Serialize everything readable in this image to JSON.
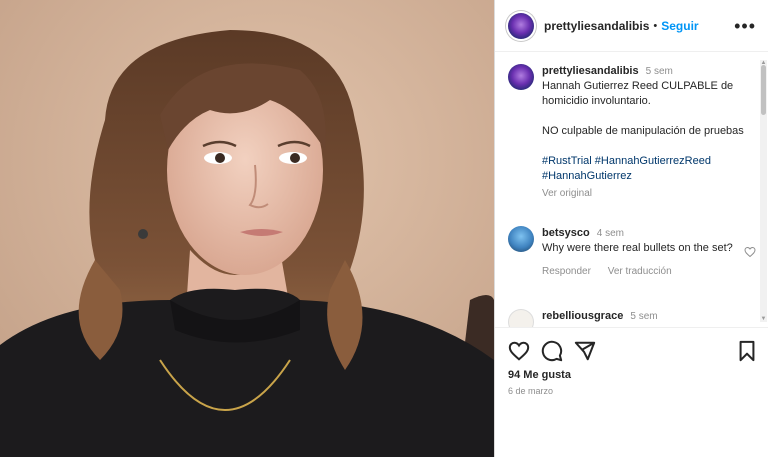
{
  "post": {
    "username": "prettyliesandalibis",
    "follow_label": "Seguir",
    "separator": "•",
    "more_label": "•••"
  },
  "caption": {
    "username": "prettyliesandalibis",
    "time": "5 sem",
    "line1": "Hannah Gutierrez Reed CULPABLE de homicidio involuntario.",
    "line2": "NO culpable de manipulación de pruebas",
    "hashtags": [
      "#RustTrial",
      "#HannahGutierrezReed",
      "#HannahGutierrez"
    ],
    "translate": "Ver original"
  },
  "comments": [
    {
      "username": "betsysco",
      "time": "4 sem",
      "text": "Why were there real bullets on the set?",
      "reply": "Responder",
      "translate": "Ver traducción"
    },
    {
      "username": "rebelliousgrace",
      "time": "5 sem",
      "text": ""
    }
  ],
  "actions": {
    "likes": "94 Me gusta",
    "date": "6 de marzo"
  },
  "icons": {
    "like": "heart-icon",
    "comment": "comment-icon",
    "share": "share-icon",
    "save": "bookmark-icon",
    "more": "more-icon",
    "comment_like": "heart-icon"
  }
}
